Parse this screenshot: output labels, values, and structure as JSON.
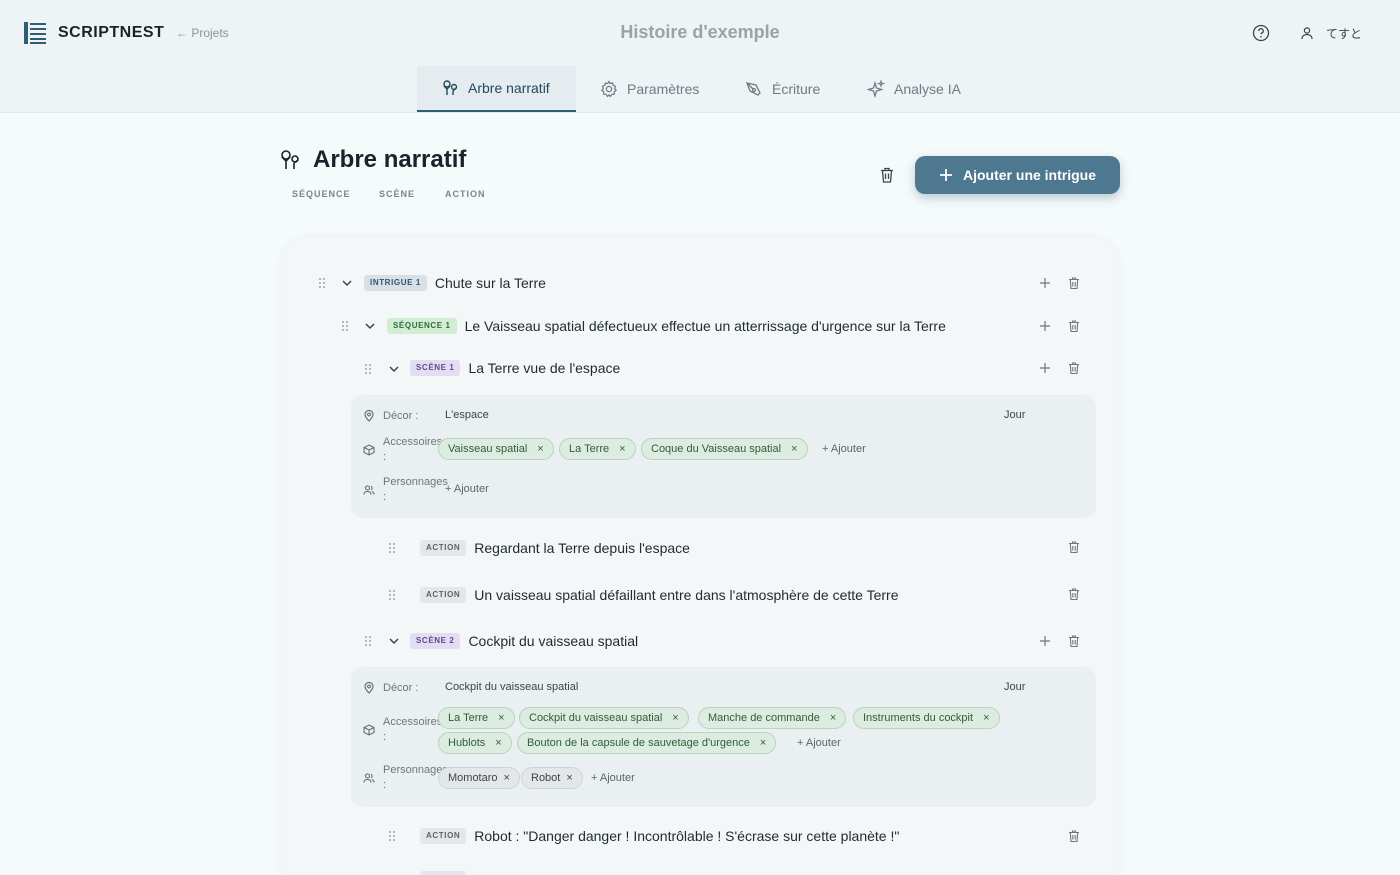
{
  "app": {
    "brand": "SCRIPTNEST",
    "back_label": "← Projets",
    "page_title": "Histoire d'exemple",
    "user_name": "てすと"
  },
  "tabs": [
    {
      "label": "Arbre narratif",
      "active": true
    },
    {
      "label": "Paramètres"
    },
    {
      "label": "Écriture"
    },
    {
      "label": "Analyse IA"
    }
  ],
  "header": {
    "title": "Arbre narratif",
    "subnav": [
      "SÉQUENCE",
      "SCÈNE",
      "ACTION"
    ],
    "add_button": "Ajouter une intrigue"
  },
  "tree": {
    "intrigue": {
      "badge": "INTRIGUE 1",
      "title": "Chute sur la Terre"
    },
    "sequence": {
      "badge": "SÉQUENCE 1",
      "title": "Le Vaisseau spatial défectueux effectue un atterrissage d'urgence sur la Terre"
    },
    "scene1": {
      "badge": "SCÈNE 1",
      "title": "La Terre vue de l'espace",
      "decor_label": "Décor :",
      "decor": "L'espace",
      "time": "Jour",
      "props_label_a": "Accessoires",
      "props_label_b": ":",
      "props": [
        "Vaisseau spatial",
        "La Terre",
        "Coque du Vaisseau spatial"
      ],
      "add_label": "+ Ajouter",
      "chars_label_a": "Personnages",
      "chars_label_b": ":",
      "chars_add": "+ Ajouter"
    },
    "actions1": [
      {
        "badge": "ACTION",
        "text": "Regardant la Terre depuis l'espace"
      },
      {
        "badge": "ACTION",
        "text": "Un vaisseau spatial défaillant entre dans l'atmosphère de cette Terre"
      }
    ],
    "scene2": {
      "badge": "SCÈNE 2",
      "title": "Cockpit du vaisseau spatial",
      "decor_label": "Décor :",
      "decor": "Cockpit du vaisseau spatial",
      "time": "Jour",
      "props_label_a": "Accessoires",
      "props_label_b": ":",
      "props": [
        "La Terre",
        "Cockpit du vaisseau spatial",
        "Manche de commande",
        "Instruments du cockpit",
        "Hublots",
        "Bouton de la capsule de sauvetage d'urgence"
      ],
      "add_label": "+ Ajouter",
      "chars_label_a": "Personnages",
      "chars_label_b": ":",
      "chars": [
        "Momotaro",
        "Robot"
      ],
      "chars_add": "+ Ajouter"
    },
    "actions2": [
      {
        "badge": "ACTION",
        "text": "Robot : \"Danger danger ! Incontrôlable ! S'écrase sur cette planète !\""
      }
    ],
    "chip_remove": "×"
  }
}
